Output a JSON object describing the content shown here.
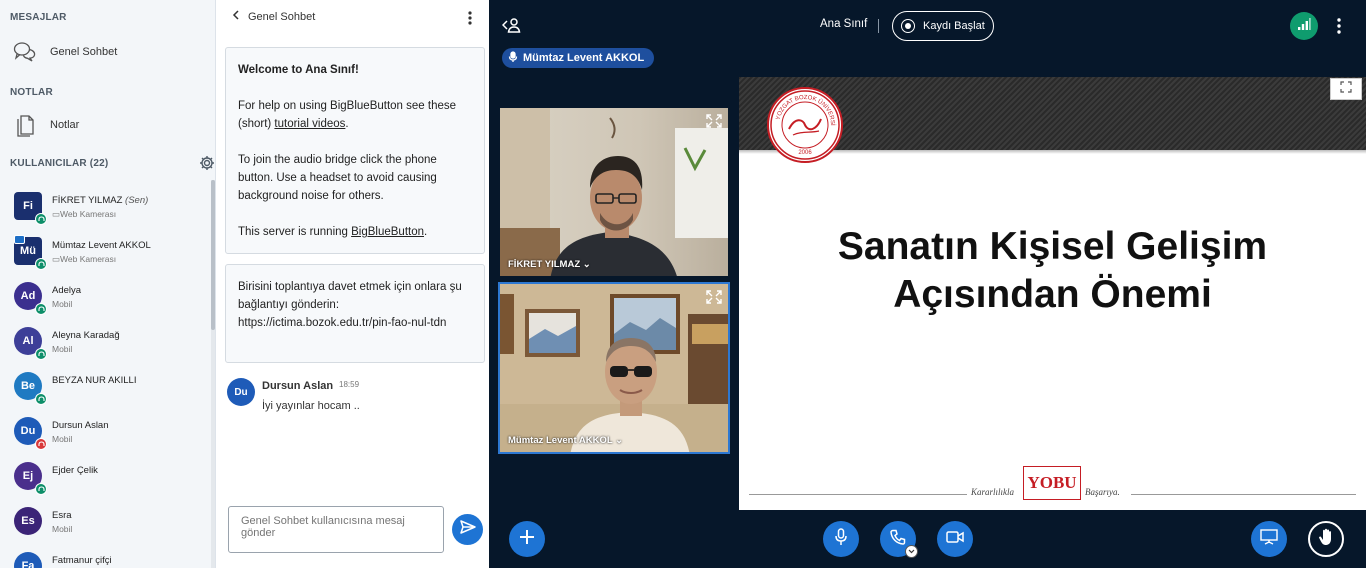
{
  "sidebar": {
    "messages_title": "MESAJLAR",
    "public_chat_label": "Genel Sohbet",
    "notes_title": "NOTLAR",
    "notes_label": "Notlar",
    "users_title": "KULLANICILAR (22)"
  },
  "users": [
    {
      "initials": "Fi",
      "name": "FİKRET YILMAZ",
      "you": "(Sen)",
      "sub": "Web Kamerası",
      "color": "#1a2f6e",
      "badge": "#0e8f6a"
    },
    {
      "initials": "Mü",
      "name": "Mümtaz Levent AKKOL",
      "you": "",
      "sub": "Web Kamerası",
      "color": "#1a2f6e",
      "badge": "#0e8f6a"
    },
    {
      "initials": "Ad",
      "name": "Adelya",
      "you": "",
      "sub": "Mobil",
      "color": "#3b2f8f",
      "badge": "#0e8f6a"
    },
    {
      "initials": "Al",
      "name": "Aleyna Karadağ",
      "you": "",
      "sub": "Mobil",
      "color": "#3d3f98",
      "badge": "#0e8f6a"
    },
    {
      "initials": "Be",
      "name": "BEYZA NUR AKILLI",
      "you": "",
      "sub": "",
      "color": "#1f7ac2",
      "badge": "#0e8f6a"
    },
    {
      "initials": "Du",
      "name": "Dursun Aslan",
      "you": "",
      "sub": "Mobil",
      "color": "#1e5bb8",
      "badge": "#d9383a"
    },
    {
      "initials": "Ej",
      "name": "Ejder Çelik",
      "you": "",
      "sub": "",
      "color": "#4a2f8c",
      "badge": "#0e8f6a"
    },
    {
      "initials": "Es",
      "name": "Esra",
      "you": "",
      "sub": "Mobil",
      "color": "#3b2477",
      "badge": ""
    },
    {
      "initials": "Fa",
      "name": "Fatmanur çifçi",
      "you": "",
      "sub": "",
      "color": "#1e5bb8",
      "badge": ""
    }
  ],
  "chat": {
    "title": "Genel Sohbet",
    "welcome": {
      "line1_pre": "Welcome to ",
      "line1_bold": "Ana Sınıf",
      "line1_post": "!",
      "line2_pre": "For help on using BigBlueButton see these (short) ",
      "line2_link": "tutorial videos",
      "line2_post": ".",
      "line3": "To join the audio bridge click the phone button. Use a headset to avoid causing background noise for others.",
      "line4_pre": "This server is running ",
      "line4_link": "BigBlueButton",
      "line4_post": "."
    },
    "invite": "Birisini toplantıya davet etmek için onlara şu bağlantıyı gönderin: https://ictima.bozok.edu.tr/pin-fao-nul-tdn",
    "message": {
      "initials": "Du",
      "sender": "Dursun Aslan",
      "time": "18:59",
      "text": "İyi yayınlar hocam .."
    },
    "input_placeholder": "Genel Sohbet kullanıcısına mesaj gönder"
  },
  "main": {
    "meeting_title": "Ana Sınıf",
    "record_label": "Kaydı Başlat",
    "talking_user": "Mümtaz Levent AKKOL",
    "videos": [
      {
        "name": "FİKRET YILMAZ"
      },
      {
        "name": "Mümtaz Levent AKKOL"
      }
    ],
    "slide": {
      "title_line1": "Sanatın Kişisel Gelişim",
      "title_line2": "Açısından Önemi",
      "seal_text": "YOZGAT BOZOK ÜNİVERSİTESİ",
      "seal_year": "2006",
      "logo_text": "YOBU",
      "footer_left": "Kararlılıkla",
      "footer_right": "Başarıya."
    }
  },
  "colors": {
    "accent": "#1e74d4",
    "main_bg": "#06172a",
    "connection_ok": "#0f9c6e"
  }
}
